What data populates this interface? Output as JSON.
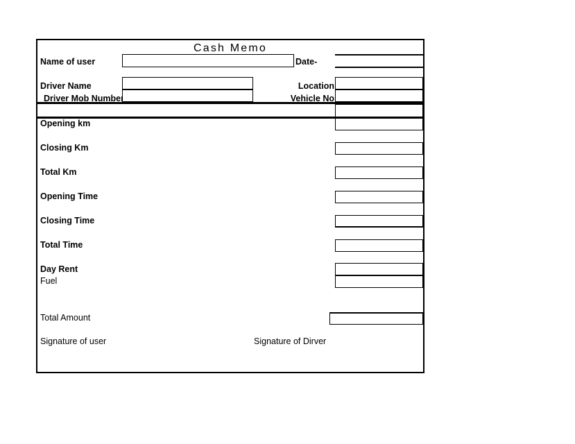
{
  "document": {
    "title": "Cash Memo"
  },
  "header": {
    "name_of_user_label": "Name of user",
    "name_of_user_value": "",
    "date_label": "Date-",
    "date_value": "",
    "driver_name_label": "Driver Name",
    "driver_name_value": "",
    "driver_mob_number_label": "Driver Mob Number",
    "driver_mob_number_value": "",
    "location_label": "Location",
    "location_value": "",
    "vehicle_no_label": "Vehicle No",
    "vehicle_no_value": ""
  },
  "rows": [
    {
      "label": "Opening km",
      "value": "",
      "bold": true
    },
    {
      "label": "Closing Km",
      "value": "",
      "bold": true
    },
    {
      "label": "Total Km",
      "value": "",
      "bold": true
    },
    {
      "label": "Opening Time",
      "value": "",
      "bold": true
    },
    {
      "label": "Closing Time",
      "value": "",
      "bold": true
    },
    {
      "label": "Total Time",
      "value": "",
      "bold": true
    },
    {
      "label": "Day Rent",
      "value": "",
      "bold": true
    },
    {
      "label": "Fuel",
      "value": "",
      "bold": false
    },
    {
      "label": "Total Amount",
      "value": "",
      "bold": false
    }
  ],
  "footer": {
    "signature_user_label": "Signature of user",
    "signature_driver_label": "Signature of Dirver"
  },
  "colors": {
    "ink": "#000000",
    "paper": "#ffffff"
  }
}
